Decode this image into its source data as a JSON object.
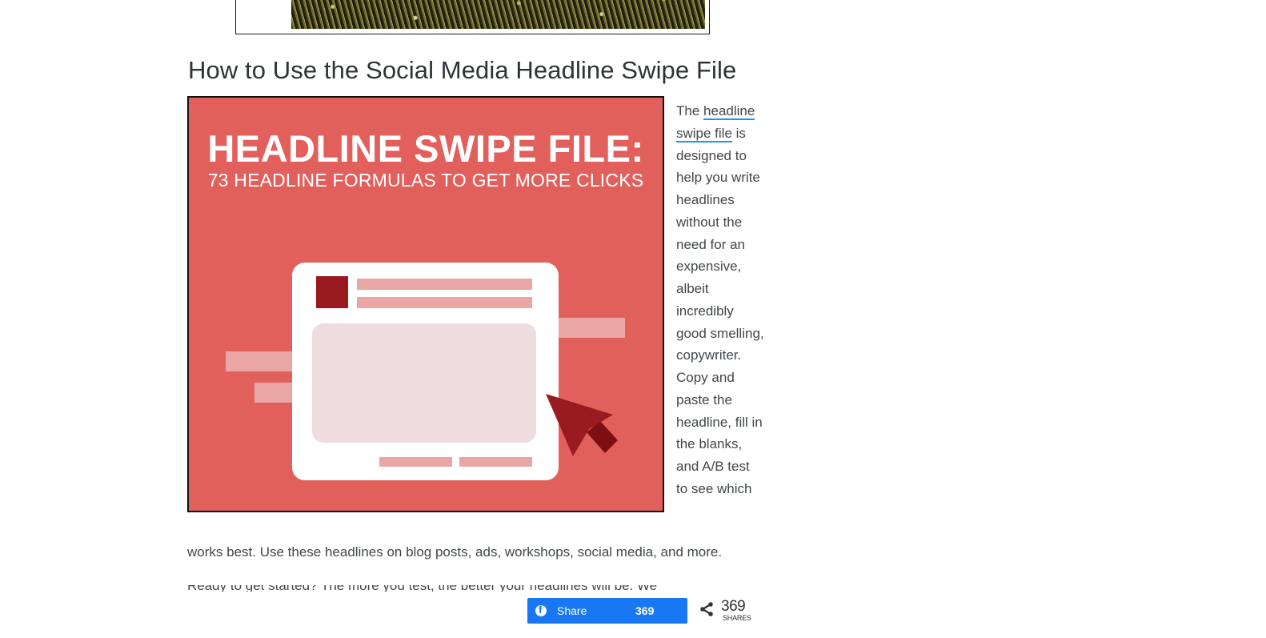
{
  "article": {
    "section_title": "How to Use the Social Media Headline Swipe File",
    "illustration": {
      "title": "HEADLINE SWIPE FILE:",
      "subtitle": "73 HEADLINE FORMULAS TO GET MORE CLICKS"
    },
    "paragraph": {
      "prefix": "The ",
      "link_text": "headline swipe file",
      "side_body": " is designed to help you write headlines without the need for an expensive, albeit incredibly good smelling, copywriter. Copy and paste the headline, fill in the blanks, and A/B test to see which",
      "tail": "works best. Use these headlines on blog posts, ads, workshops, social media, and more."
    },
    "next_paragraph_partial": "Ready to get started? The more you test, the better your headlines will be. We"
  },
  "colors": {
    "illustration_bg": "#e2605c",
    "accent_dark_red": "#9a1b1f",
    "link_underline": "#1a9ae6",
    "facebook_blue": "#1877f2"
  },
  "share_bar": {
    "facebook": {
      "icon": "facebook-icon",
      "label": "Share",
      "count": "369"
    },
    "total": {
      "icon": "share-icon",
      "count": "369",
      "label": "SHARES"
    }
  }
}
